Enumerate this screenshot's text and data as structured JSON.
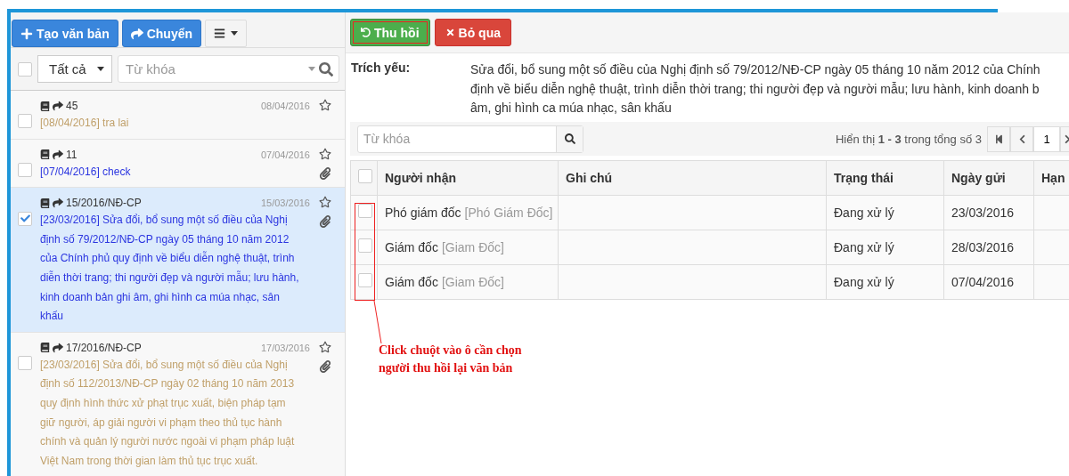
{
  "toolbar": {
    "buttons": [
      {
        "label": "Tạo văn bản",
        "kind": "create"
      },
      {
        "label": "Chuyển",
        "kind": "forward"
      }
    ]
  },
  "filter": {
    "select_all_checked": false,
    "scope": "Tất cả",
    "search_placeholder": "Từ khóa"
  },
  "documents": [
    {
      "number": "45",
      "date": "08/04/2016",
      "summary": "[08/04/2016] tra lai",
      "unread": false,
      "checked": false,
      "selected": false,
      "attachment": false
    },
    {
      "number": "11",
      "date": "07/04/2016",
      "summary": "[07/04/2016] check",
      "unread": true,
      "checked": false,
      "selected": false,
      "attachment": true
    },
    {
      "number": "15/2016/NĐ-CP",
      "date": "15/03/2016",
      "summary": "[23/03/2016] Sửa đổi, bổ sung một số điều của Nghị định số 79/2012/NĐ-CP ngày 05 tháng 10 năm 2012 của Chính phủ quy định về biểu diễn nghệ thuật, trình diễn thời trang; thi người đẹp và người mẫu; lưu hành, kinh doanh bản ghi âm, ghi hình ca múa nhạc, sân khấu",
      "unread": true,
      "checked": true,
      "selected": true,
      "attachment": true
    },
    {
      "number": "17/2016/NĐ-CP",
      "date": "17/03/2016",
      "summary": "[23/03/2016] Sửa đổi, bổ sung một số điều của Nghị định số 112/2013/NĐ-CP ngày 02 tháng 10 năm 2013 quy định hình thức xử phạt trục xuất, biện pháp tạm giữ người, áp giải người vi phạm theo thủ tục hành chính và quản lý người nước ngoài vi phạm pháp luật Việt Nam trong thời gian làm thủ tục trục xuất.",
      "unread": false,
      "checked": false,
      "selected": false,
      "attachment": true
    }
  ],
  "actions": [
    {
      "label": "Thu hồi",
      "kind": "recall",
      "outlined": true
    },
    {
      "label": "Bỏ qua",
      "kind": "dismiss",
      "outlined": false
    }
  ],
  "summary": {
    "label": "Trích yếu:",
    "lines": [
      "Sửa đổi, bổ sung một số điều của Nghị định số 79/2012/NĐ-CP ngày 05 tháng 10 năm 2012 của Chính",
      "định về biểu diễn nghệ thuật, trình diễn thời trang; thi người đẹp và người mẫu; lưu hành, kinh doanh b",
      "âm, ghi hình ca múa nhạc, sân khấu"
    ]
  },
  "recipients": {
    "search_placeholder": "Từ khóa",
    "paging_text": "Hiển thị **1 - 3** trong tổng số 3",
    "page": "1",
    "select_all_checked": false,
    "columns": [
      "Người nhận",
      "Ghi chú",
      "Trạng thái",
      "Ngày gửi",
      "Hạn"
    ],
    "rows": [
      {
        "name": "Phó giám đốc",
        "role": "[Phó Giám Đốc]",
        "status": "Đang xử lý",
        "date": "23/03/2016",
        "checked": false
      },
      {
        "name": "Giám đốc",
        "role": "[Giam Đốc]",
        "status": "Đang xử lý",
        "date": "28/03/2016",
        "checked": false
      },
      {
        "name": "Giám đốc",
        "role": "[Giam Đốc]",
        "status": "Đang xử lý",
        "date": "07/04/2016",
        "checked": false
      }
    ]
  },
  "annotation": {
    "lines": [
      "Click chuột vào ô cần chọn",
      "người thu hồi lại văn bản"
    ]
  }
}
